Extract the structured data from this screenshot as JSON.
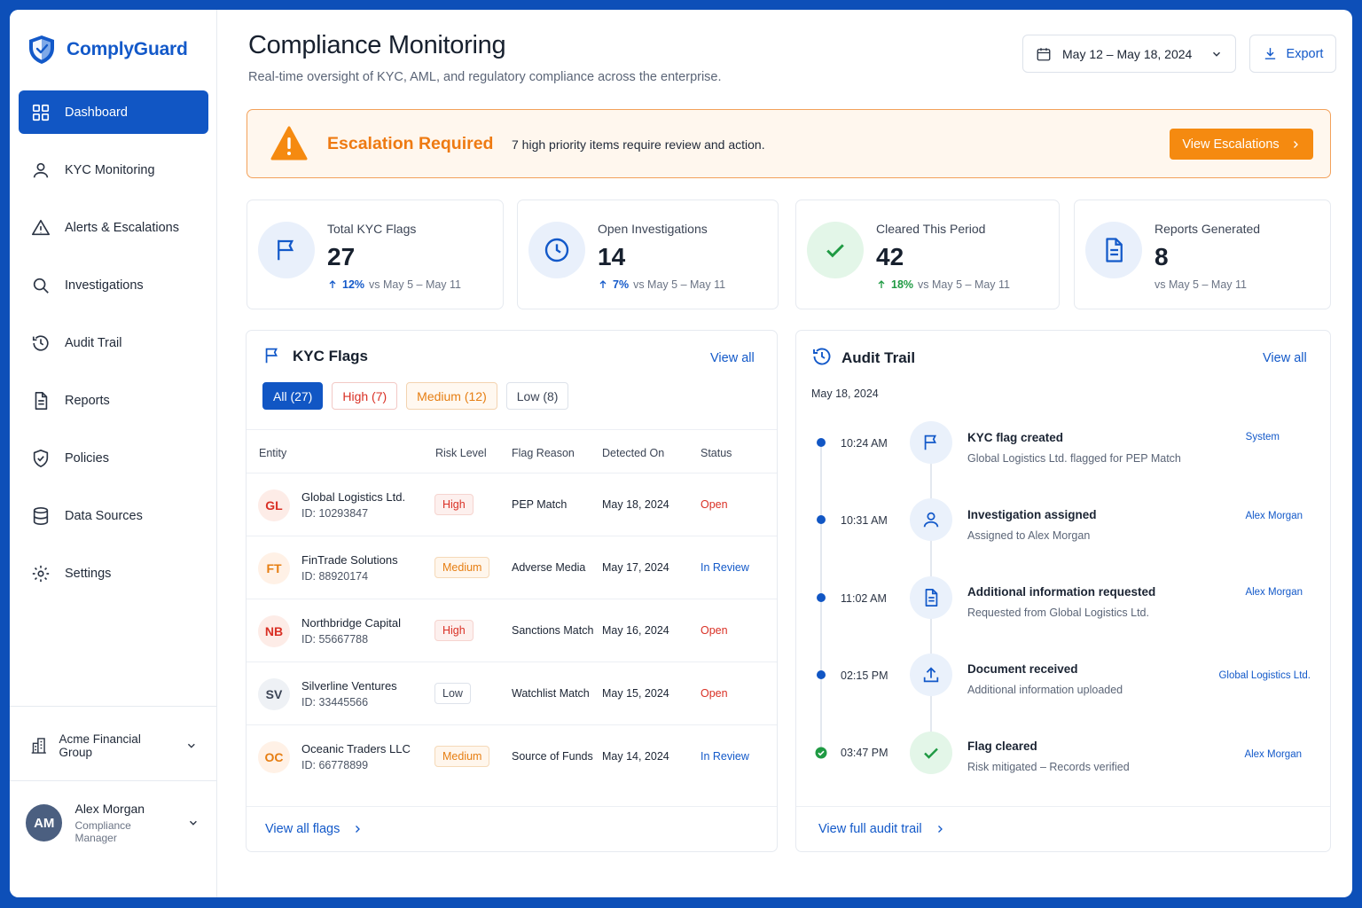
{
  "brand": {
    "name": "ComplyGuard"
  },
  "sidebar": {
    "items": [
      {
        "label": "Dashboard",
        "icon": "grid-icon",
        "active": true
      },
      {
        "label": "KYC Monitoring",
        "icon": "user-icon"
      },
      {
        "label": "Alerts & Escalations",
        "icon": "warning-icon"
      },
      {
        "label": "Investigations",
        "icon": "search-icon"
      },
      {
        "label": "Audit Trail",
        "icon": "history-icon"
      },
      {
        "label": "Reports",
        "icon": "document-icon"
      },
      {
        "label": "Policies",
        "icon": "shield-check-icon"
      },
      {
        "label": "Data Sources",
        "icon": "database-icon"
      },
      {
        "label": "Settings",
        "icon": "gear-icon"
      }
    ],
    "org": "Acme Financial Group",
    "user": {
      "initials": "AM",
      "name": "Alex Morgan",
      "role": "Compliance Manager"
    }
  },
  "header": {
    "title": "Compliance Monitoring",
    "subtitle": "Real-time oversight of KYC, AML, and regulatory compliance across the enterprise.",
    "date_range": "May 12 – May 18, 2024",
    "export_label": "Export"
  },
  "banner": {
    "title": "Escalation Required",
    "text": "7 high priority items require review and action.",
    "button": "View Escalations"
  },
  "stats": [
    {
      "label": "Total KYC Flags",
      "value": "27",
      "delta": "12%",
      "compare": "vs May 5 – May 11",
      "color": "blue"
    },
    {
      "label": "Open Investigations",
      "value": "14",
      "delta": "7%",
      "compare": "vs May 5 – May 11",
      "color": "blue"
    },
    {
      "label": "Cleared This Period",
      "value": "42",
      "delta": "18%",
      "compare": "vs May 5 – May 11",
      "color": "green"
    },
    {
      "label": "Reports Generated",
      "value": "8",
      "delta": "",
      "compare": "vs May 5 – May 11",
      "color": "blue"
    }
  ],
  "kyc": {
    "title": "KYC Flags",
    "view_all": "View all",
    "filters": [
      "All (27)",
      "High (7)",
      "Medium (12)",
      "Low (8)"
    ],
    "columns": [
      "Entity",
      "Risk Level",
      "Flag Reason",
      "Detected On",
      "Status"
    ],
    "rows": [
      {
        "initials": "GL",
        "name": "Global Logistics Ltd.",
        "id": "ID: 10293847",
        "risk": "High",
        "reason": "PEP Match",
        "date": "May 18, 2024",
        "status": "Open"
      },
      {
        "initials": "FT",
        "name": "FinTrade Solutions",
        "id": "ID: 88920174",
        "risk": "Medium",
        "reason": "Adverse Media",
        "date": "May 17, 2024",
        "status": "In Review"
      },
      {
        "initials": "NB",
        "name": "Northbridge Capital",
        "id": "ID: 55667788",
        "risk": "High",
        "reason": "Sanctions Match",
        "date": "May 16, 2024",
        "status": "Open"
      },
      {
        "initials": "SV",
        "name": "Silverline Ventures",
        "id": "ID: 33445566",
        "risk": "Low",
        "reason": "Watchlist Match",
        "date": "May 15, 2024",
        "status": "Open"
      },
      {
        "initials": "OC",
        "name": "Oceanic Traders LLC",
        "id": "ID: 66778899",
        "risk": "Medium",
        "reason": "Source of Funds",
        "date": "May 14, 2024",
        "status": "In Review"
      }
    ],
    "footer_link": "View all flags"
  },
  "audit": {
    "title": "Audit Trail",
    "view_all": "View all",
    "date": "May 18, 2024",
    "events": [
      {
        "time": "10:24 AM",
        "icon": "flag-icon",
        "title": "KYC flag created",
        "desc": "Global Logistics Ltd. flagged for PEP Match",
        "actor": "System"
      },
      {
        "time": "10:31 AM",
        "icon": "user-icon",
        "title": "Investigation assigned",
        "desc": "Assigned to Alex Morgan",
        "actor": "Alex Morgan"
      },
      {
        "time": "11:02 AM",
        "icon": "document-icon",
        "title": "Additional information requested",
        "desc": "Requested from Global Logistics Ltd.",
        "actor": "Alex Morgan"
      },
      {
        "time": "02:15 PM",
        "icon": "upload-icon",
        "title": "Document received",
        "desc": "Additional information uploaded",
        "actor": "Global Logistics Ltd."
      },
      {
        "time": "03:47 PM",
        "icon": "check-icon",
        "title": "Flag cleared",
        "desc": "Risk mitigated – Records verified",
        "actor": "Alex Morgan"
      }
    ],
    "footer_link": "View full audit trail"
  },
  "colors": {
    "primary": "#1156c4",
    "accent": "#f58a10",
    "high": "#d93025",
    "medium": "#e67e12",
    "success": "#1f9a43"
  }
}
